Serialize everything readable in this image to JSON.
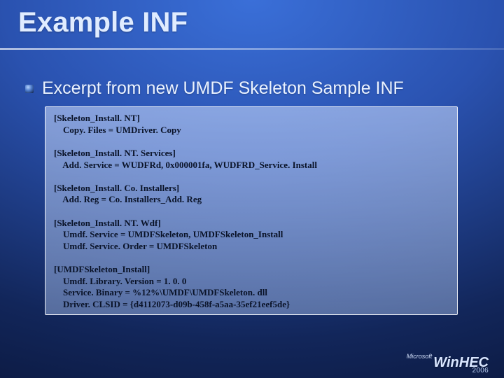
{
  "title": "Example INF",
  "subtitle": "Excerpt from new UMDF Skeleton Sample INF",
  "code": "[Skeleton_Install. NT]\n    Copy. Files = UMDriver. Copy\n\n[Skeleton_Install. NT. Services]\n    Add. Service = WUDFRd, 0x000001fa, WUDFRD_Service. Install\n\n[Skeleton_Install. Co. Installers]\n    Add. Reg = Co. Installers_Add. Reg\n\n[Skeleton_Install. NT. Wdf]\n    Umdf. Service = UMDFSkeleton, UMDFSkeleton_Install\n    Umdf. Service. Order = UMDFSkeleton\n\n[UMDFSkeleton_Install]\n    Umdf. Library. Version = 1. 0. 0\n    Service. Binary = %12%\\UMDF\\UMDFSkeleton. dll\n    Driver. CLSID = {d4112073-d09b-458f-a5aa-35ef21eef5de}",
  "footer": {
    "vendor": "Microsoft",
    "brand": "WinHEC",
    "year": "2006"
  }
}
